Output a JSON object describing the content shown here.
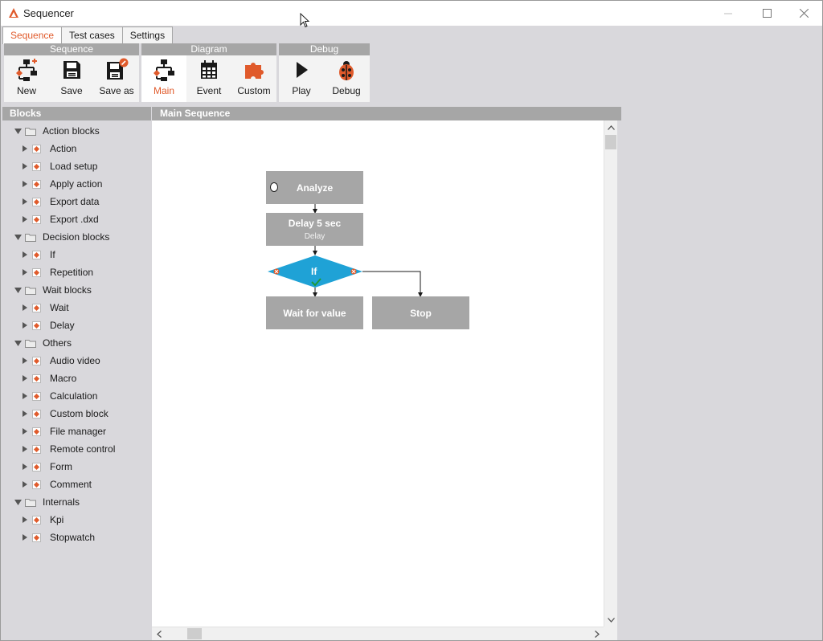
{
  "window": {
    "title": "Sequencer"
  },
  "tabs": [
    {
      "label": "Sequence",
      "active": true
    },
    {
      "label": "Test cases",
      "active": false
    },
    {
      "label": "Settings",
      "active": false
    }
  ],
  "ribbon": {
    "sequence": {
      "title": "Sequence",
      "new": "New",
      "save": "Save",
      "save_as": "Save as"
    },
    "diagram": {
      "title": "Diagram",
      "main": "Main",
      "event": "Event",
      "custom": "Custom"
    },
    "debug": {
      "title": "Debug",
      "play": "Play",
      "debug": "Debug"
    }
  },
  "blocks": {
    "header": "Blocks",
    "groups": [
      {
        "label": "Action blocks",
        "items": [
          "Action",
          "Load setup",
          "Apply action",
          "Export data",
          "Export .dxd"
        ]
      },
      {
        "label": "Decision blocks",
        "items": [
          "If",
          "Repetition"
        ]
      },
      {
        "label": "Wait blocks",
        "items": [
          "Wait",
          "Delay"
        ]
      },
      {
        "label": "Others",
        "items": [
          "Audio video",
          "Macro",
          "Calculation",
          "Custom block",
          "File manager",
          "Remote control",
          "Form",
          "Comment"
        ]
      },
      {
        "label": "Internals",
        "items": [
          "Kpi",
          "Stopwatch"
        ]
      }
    ]
  },
  "main": {
    "header": "Main Sequence",
    "nodes": {
      "analyze": "Analyze",
      "delay": "Delay 5 sec",
      "delay_sub": "Delay",
      "if": "If",
      "wait": "Wait for value",
      "stop": "Stop"
    }
  },
  "colors": {
    "accent": "#e05a2b",
    "node": "#a6a6a6",
    "decision": "#1fa2d6",
    "header": "#a6a6a6"
  }
}
